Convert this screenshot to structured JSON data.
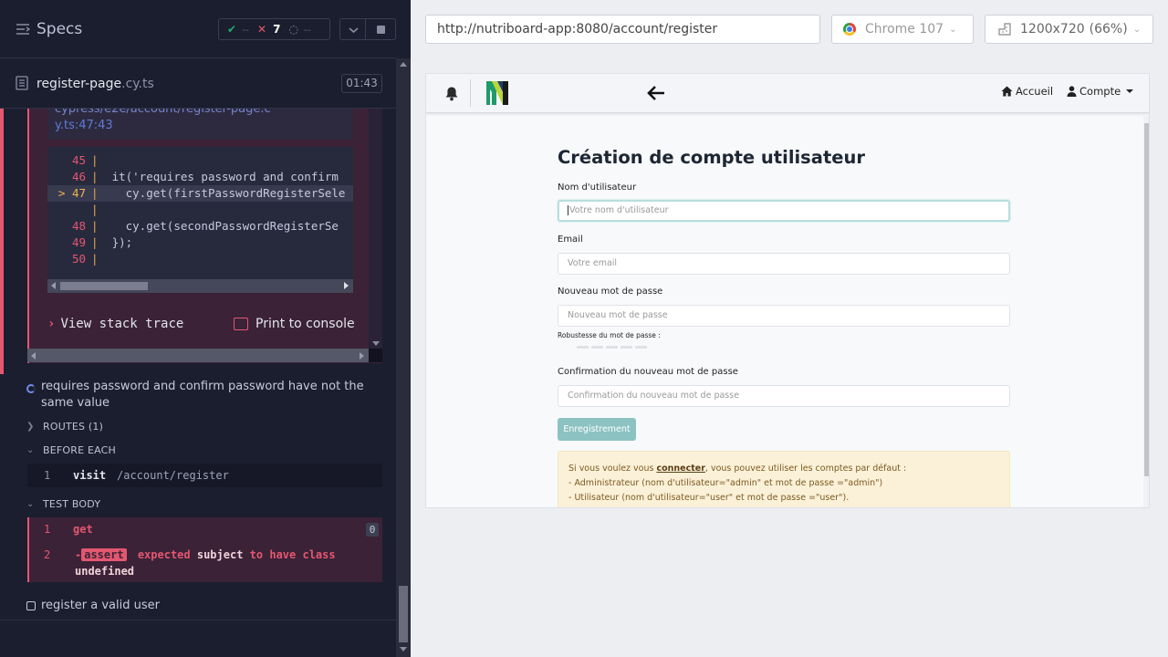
{
  "reporter": {
    "header": {
      "title": "Specs",
      "stats": {
        "passed": "--",
        "failed": "7",
        "pending": "--"
      }
    },
    "file": {
      "name": "register-page",
      "ext": ".cy.ts",
      "duration": "01:43"
    },
    "error": {
      "file_line_1": "cypress/e2e/account/register-page.c",
      "file_line_2": "y.ts:47:43",
      "code": [
        {
          "num": "45",
          "text": ""
        },
        {
          "num": "46",
          "text": "  it('requires password and confirm"
        },
        {
          "num": "47",
          "text": "    cy.get(firstPasswordRegisterSele"
        },
        {
          "num": "",
          "text": ""
        },
        {
          "num": "48",
          "text": "    cy.get(secondPasswordRegisterSe"
        },
        {
          "num": "49",
          "text": "  });"
        },
        {
          "num": "50",
          "text": ""
        }
      ],
      "current_marker": ">",
      "view_stack_trace": "View stack trace",
      "print_to_console": "Print to console"
    },
    "test_title": "requires password and confirm password have not the same value",
    "sections": {
      "routes": "ROUTES (1)",
      "before_each": "BEFORE EACH",
      "test_body": "TEST BODY"
    },
    "before_each_cmd": {
      "num": "1",
      "name": "visit",
      "arg": "/account/register"
    },
    "body_cmds": {
      "get": {
        "num": "1",
        "name": "get",
        "count": "0"
      },
      "assert": {
        "num": "2",
        "dash": "-",
        "badge": "assert",
        "w1": "expected",
        "w2": "subject",
        "w3": "to have class",
        "w4": "undefined"
      }
    },
    "second_test": "register a valid user"
  },
  "browser": {
    "url": "http://nutriboard-app:8080/account/register",
    "browser_name": "Chrome 107",
    "viewport": "1200x720",
    "zoom": "(66%)"
  },
  "app": {
    "nav": {
      "home": "Accueil",
      "account": "Compte"
    },
    "title": "Création de compte utilisateur",
    "fields": {
      "username": {
        "label": "Nom d'utilisateur",
        "placeholder": "Votre nom d'utilisateur"
      },
      "email": {
        "label": "Email",
        "placeholder": "Votre email"
      },
      "password": {
        "label": "Nouveau mot de passe",
        "placeholder": "Nouveau mot de passe"
      },
      "strength_label": "Robustesse du mot de passe :",
      "confirm": {
        "label": "Confirmation du nouveau mot de passe",
        "placeholder": "Confirmation du nouveau mot de passe"
      }
    },
    "submit": "Enregistrement",
    "alert": {
      "prefix": "Si vous voulez vous ",
      "link": "connecter",
      "suffix": ", vous pouvez utiliser les comptes par défaut :",
      "line2": "- Administrateur (nom d'utilisateur=\"admin\" et mot de passe =\"admin\")",
      "line3": "- Utilisateur (nom d'utilisateur=\"user\" et mot de passe =\"user\")."
    }
  },
  "colors": {
    "fail": "#e45770",
    "pass": "#1fa971",
    "accent": "#8cc3c2",
    "panel": "#1b1e2e"
  }
}
